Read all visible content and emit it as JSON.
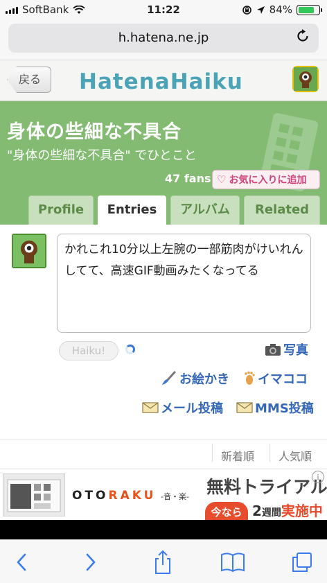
{
  "status_bar": {
    "carrier": "SoftBank",
    "time": "11:22",
    "battery": "84%",
    "battery_level": 0.84
  },
  "browser": {
    "url": "h.hatena.ne.jp"
  },
  "header": {
    "back_label": "戻る",
    "logo_text": "HatenaHaiku"
  },
  "banner": {
    "title": "身体の些細な不具合",
    "subtitle": "\"身体の些細な不具合\" でひとこと",
    "fans": "47 fans",
    "fav_label": "お気に入りに追加"
  },
  "tabs": [
    {
      "label": "Profile",
      "active": false
    },
    {
      "label": "Entries",
      "active": true
    },
    {
      "label": "アルバム",
      "active": false
    },
    {
      "label": "Related",
      "active": false
    }
  ],
  "entry": {
    "text": "かれこれ10分以上左腕の一部筋肉がけいれんしてて、高速GIF動画みたくなってる",
    "haiku_button": "Haiku!",
    "photo_label": "写真",
    "draw_label": "お絵かき",
    "imakoko_label": "イマココ",
    "mail_label": "メール投稿",
    "mms_label": "MMS投稿"
  },
  "sort": {
    "newest": "新着順",
    "popular": "人気順"
  },
  "ad": {
    "brand_prefix": "OTO",
    "brand_highlight": "RAKU",
    "brand_sub": "-音・楽-",
    "headline": "無料トライアル",
    "badge": "今なら",
    "week_num": "2",
    "week_unit": "週間",
    "week_status": "実施中"
  },
  "colors": {
    "hatena_green": "#82bb71",
    "link_blue": "#3467b8",
    "fav_pink": "#d0437a",
    "ad_red": "#e74c2c"
  }
}
